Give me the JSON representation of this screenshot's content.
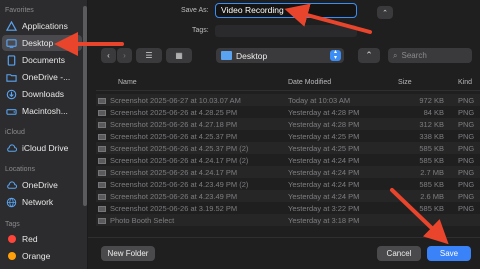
{
  "sidebar": {
    "favorites_header": "Favorites",
    "icloud_header": "iCloud",
    "locations_header": "Locations",
    "tags_header": "Tags",
    "items": [
      {
        "label": "Applications"
      },
      {
        "label": "Desktop"
      },
      {
        "label": "Documents"
      },
      {
        "label": "OneDrive -..."
      },
      {
        "label": "Downloads"
      },
      {
        "label": "Macintosh..."
      },
      {
        "label": "iCloud Drive"
      },
      {
        "label": "OneDrive"
      },
      {
        "label": "Network"
      },
      {
        "label": "Red"
      },
      {
        "label": "Orange"
      }
    ],
    "tag_colors": {
      "red": "#ff453a",
      "orange": "#ff9f0a"
    }
  },
  "form": {
    "save_as_label": "Save As:",
    "save_as_value": "Video Recording",
    "tags_label": "Tags:"
  },
  "toolbar": {
    "location": "Desktop",
    "search_placeholder": "Search"
  },
  "table": {
    "headers": {
      "name": "Name",
      "date": "Date Modified",
      "size": "Size",
      "kind": "Kind"
    },
    "rows": [
      {
        "name": "Screenshot 2025-06-27 at 10.03.07 AM",
        "date": "Today at 10:03 AM",
        "size": "972 KB",
        "kind": "PNG"
      },
      {
        "name": "Screenshot 2025-06-26 at 4.28.25 PM",
        "date": "Yesterday at 4:28 PM",
        "size": "84 KB",
        "kind": "PNG"
      },
      {
        "name": "Screenshot 2025-06-26 at 4.27.18 PM",
        "date": "Yesterday at 4:28 PM",
        "size": "312 KB",
        "kind": "PNG"
      },
      {
        "name": "Screenshot 2025-06-26 at 4.25.37 PM",
        "date": "Yesterday at 4:25 PM",
        "size": "338 KB",
        "kind": "PNG"
      },
      {
        "name": "Screenshot 2025-06-26 at 4.25.37 PM (2)",
        "date": "Yesterday at 4:25 PM",
        "size": "585 KB",
        "kind": "PNG"
      },
      {
        "name": "Screenshot 2025-06-26 at 4.24.17 PM (2)",
        "date": "Yesterday at 4:24 PM",
        "size": "585 KB",
        "kind": "PNG"
      },
      {
        "name": "Screenshot 2025-06-26 at 4.24.17 PM",
        "date": "Yesterday at 4:24 PM",
        "size": "2.7 MB",
        "kind": "PNG"
      },
      {
        "name": "Screenshot 2025-06-26 at 4.23.49 PM (2)",
        "date": "Yesterday at 4:24 PM",
        "size": "585 KB",
        "kind": "PNG"
      },
      {
        "name": "Screenshot 2025-06-26 at 4.23.49 PM",
        "date": "Yesterday at 4:24 PM",
        "size": "2.6 MB",
        "kind": "PNG"
      },
      {
        "name": "Screenshot 2025-06-26 at 3.19.52 PM",
        "date": "Yesterday at 3:22 PM",
        "size": "585 KB",
        "kind": "PNG"
      },
      {
        "name": "Photo Booth Select",
        "date": "Yesterday at 3:18 PM",
        "size": "",
        "kind": ""
      }
    ]
  },
  "buttons": {
    "new_folder": "New Folder",
    "cancel": "Cancel",
    "save": "Save"
  },
  "icons": {
    "back": "‹",
    "forward": "›",
    "list_view": "☰",
    "grid_view": "▦",
    "search": "⌕",
    "expand": "⌃"
  },
  "colors": {
    "accent": "#3a82f7",
    "annotation": "#e8452c"
  }
}
